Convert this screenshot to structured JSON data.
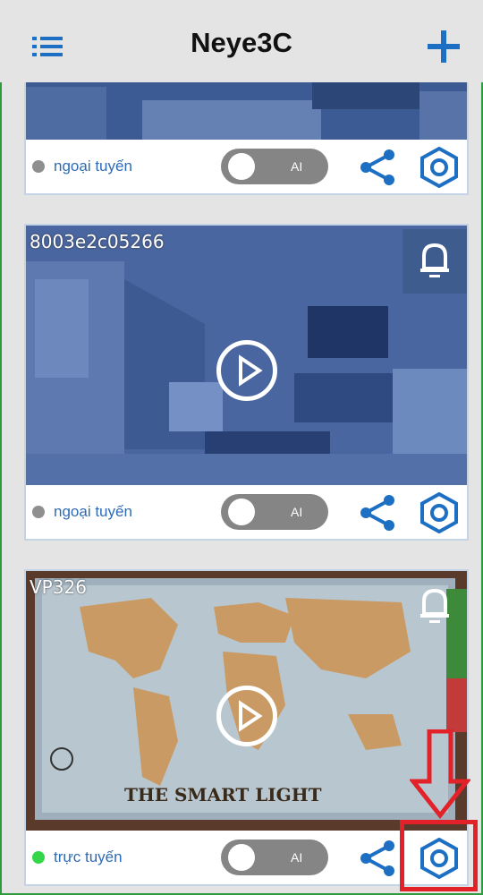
{
  "header": {
    "title": "Neye3C",
    "menu_icon": "list-menu-icon",
    "add_icon": "plus-icon"
  },
  "colors": {
    "accent": "#1d6fc4",
    "online": "#35d64a",
    "offline": "#8f8f8f",
    "highlight": "#e22128"
  },
  "cameras": [
    {
      "label": "",
      "status": "ngoại tuyến",
      "ai_label": "AI"
    },
    {
      "label": "8003e2c05266",
      "status": "ngoại tuyến",
      "ai_label": "AI"
    },
    {
      "label": "VP326",
      "status": "trực tuyến",
      "ai_label": "AI",
      "feed_text": "THE SMART LIGHT"
    }
  ]
}
